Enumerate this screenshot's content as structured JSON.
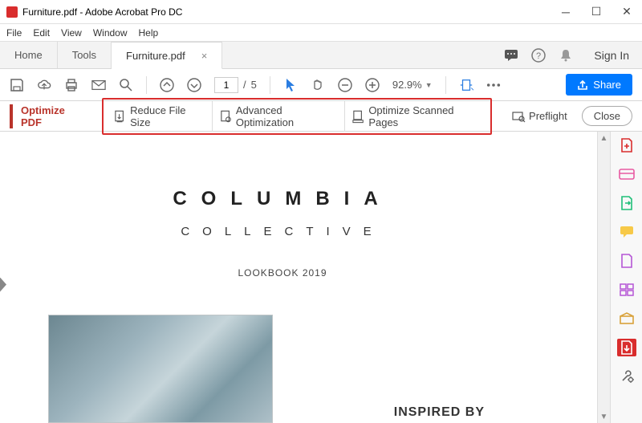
{
  "window": {
    "title": "Furniture.pdf - Adobe Acrobat Pro DC"
  },
  "menu": {
    "file": "File",
    "edit": "Edit",
    "view": "View",
    "window": "Window",
    "help": "Help"
  },
  "tabs": {
    "home": "Home",
    "tools": "Tools",
    "doc": "Furniture.pdf",
    "signin": "Sign In"
  },
  "toolbar": {
    "page_current": "1",
    "page_sep": "/",
    "page_total": "5",
    "zoom": "92.9%",
    "share": "Share"
  },
  "optimize": {
    "title": "Optimize PDF",
    "reduce": "Reduce File Size",
    "advanced": "Advanced Optimization",
    "scanned": "Optimize Scanned Pages",
    "preflight": "Preflight",
    "close": "Close"
  },
  "document": {
    "brand_top": "COLUMBIA",
    "brand_sub": "COLLECTIVE",
    "lookbook": "LOOKBOOK 2019",
    "inspired": "INSPIRED BY"
  }
}
